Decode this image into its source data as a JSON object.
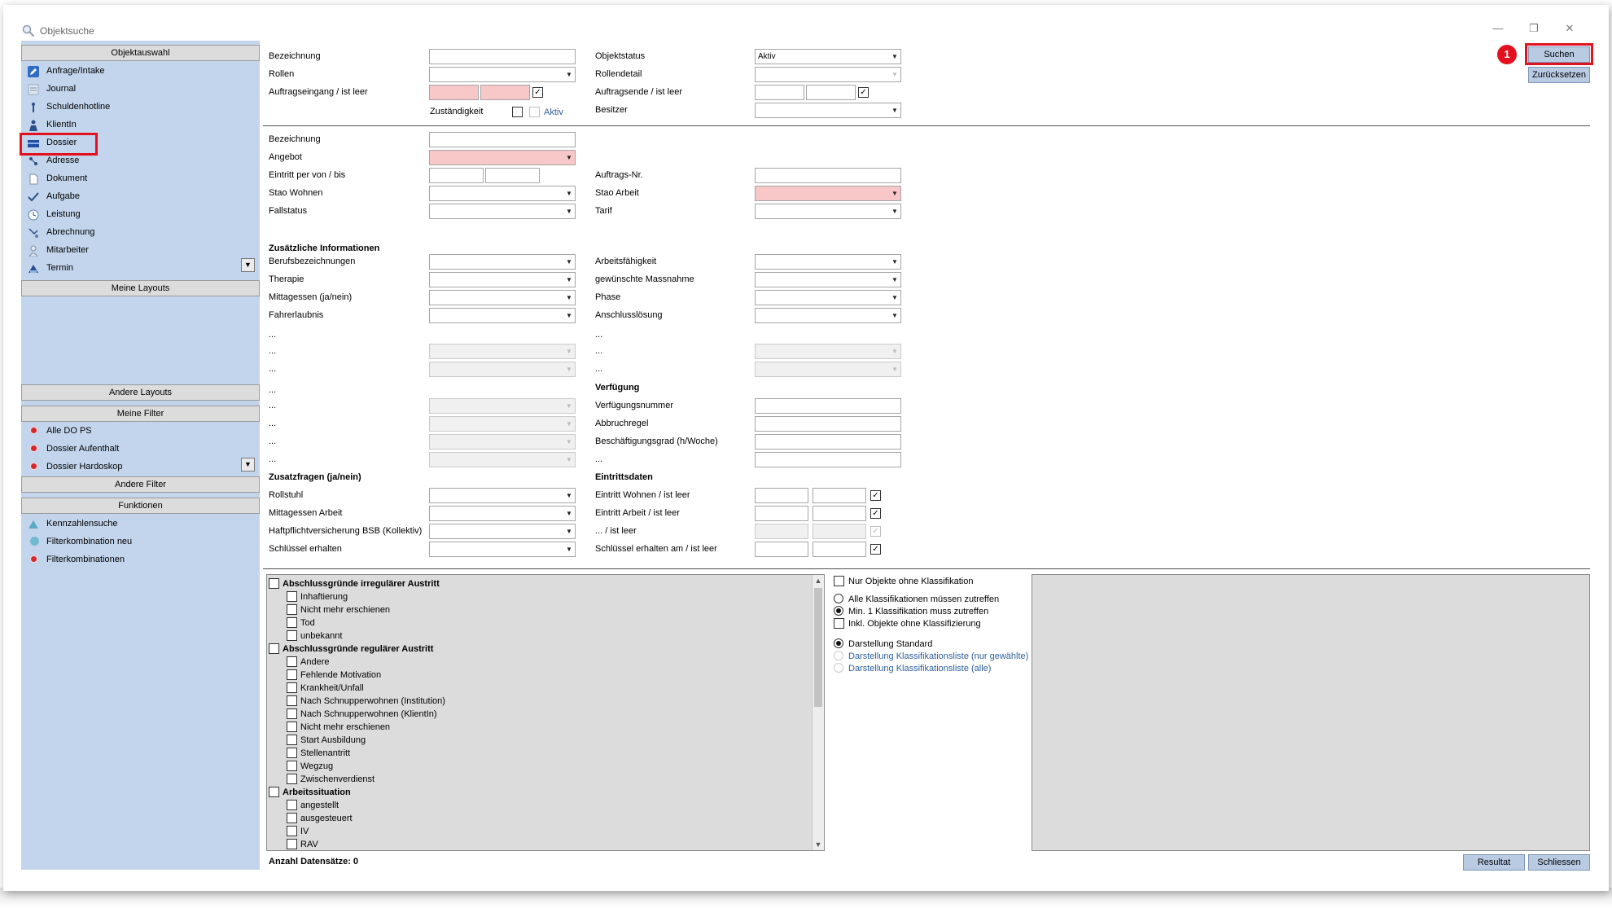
{
  "window": {
    "title": "Objektsuche",
    "controls": [
      "—",
      "❐",
      "✕"
    ]
  },
  "left": {
    "objektauswahl_header": "Objektauswahl",
    "objects": [
      {
        "label": "Anfrage/Intake",
        "icon": "pencil-icon"
      },
      {
        "label": "Journal",
        "icon": "journal-icon"
      },
      {
        "label": "Schuldenhotline",
        "icon": "person-icon"
      },
      {
        "label": "KlientIn",
        "icon": "client-icon"
      },
      {
        "label": "Dossier",
        "icon": "dossier-icon"
      },
      {
        "label": "Adresse",
        "icon": "address-icon"
      },
      {
        "label": "Dokument",
        "icon": "document-icon"
      },
      {
        "label": "Aufgabe",
        "icon": "checkmark-icon"
      },
      {
        "label": "Leistung",
        "icon": "clock-icon"
      },
      {
        "label": "Abrechnung",
        "icon": "billing-icon"
      },
      {
        "label": "Mitarbeiter",
        "icon": "employee-icon"
      },
      {
        "label": "Termin",
        "icon": "appointment-icon"
      }
    ],
    "meine_layouts_header": "Meine Layouts",
    "andere_layouts_header": "Andere Layouts",
    "meine_filter_header": "Meine Filter",
    "filters": [
      "Alle DO PS",
      "Dossier Aufenthalt",
      "Dossier Hardoskop"
    ],
    "andere_filter_header": "Andere Filter",
    "funktionen_header": "Funktionen",
    "functions": [
      {
        "label": "Kennzahlensuche",
        "icon": "teal-dot-icon"
      },
      {
        "label": "Filterkombination neu",
        "icon": "teal-dot-icon"
      },
      {
        "label": "Filterkombinationen",
        "icon": "red-dot-icon"
      }
    ]
  },
  "form": {
    "top": {
      "bezeichnung": "Bezeichnung",
      "rollen": "Rollen",
      "auftragseingang": "Auftragseingang / ist leer",
      "zustaendigkeit": "Zuständigkeit",
      "aktiv": "Aktiv",
      "objektstatus": "Objektstatus",
      "objektstatus_value": "Aktiv",
      "rollendetail": "Rollendetail",
      "auftragsende": "Auftragsende / ist leer",
      "besitzer": "Besitzer"
    },
    "dossier": {
      "bezeichnung": "Bezeichnung",
      "angebot": "Angebot",
      "eintritt": "Eintritt per von / bis",
      "stao_wohnen": "Stao Wohnen",
      "fallstatus": "Fallstatus",
      "auftrags_nr": "Auftrags-Nr.",
      "stao_arbeit": "Stao Arbeit",
      "tarif": "Tarif"
    },
    "zusatz": {
      "header": "Zusätzliche Informationen",
      "left": [
        "Berufsbezeichnungen",
        "Therapie",
        "Mittagessen (ja/nein)",
        "Fahrerlaubnis",
        "...",
        "...",
        "...",
        "...",
        "...",
        "...",
        "...",
        "..."
      ],
      "right": [
        "Arbeitsfähigkeit",
        "gewünschte Massnahme",
        "Phase",
        "Anschlusslösung",
        "...",
        "...",
        "..."
      ],
      "verfuegung_header": "Verfügung",
      "verfuegung": [
        "Verfügungsnummer",
        "Abbruchregel",
        "Beschäftigungsgrad (h/Woche)",
        "..."
      ]
    },
    "zusatzfragen": {
      "header": "Zusatzfragen (ja/nein)",
      "items": [
        "Rollstuhl",
        "Mittagessen Arbeit",
        "Haftpflichtversicherung BSB (Kollektiv)",
        "Schlüssel erhalten"
      ],
      "eintritt_header": "Eintrittsdaten",
      "eintritt": [
        "Eintritt Wohnen / ist leer",
        "Eintritt Arbeit / ist leer",
        "... / ist leer",
        "Schlüssel erhalten am / ist leer"
      ]
    }
  },
  "buttons": {
    "suchen": "Suchen",
    "zuruecksetzen": "Zurücksetzen",
    "resultat": "Resultat",
    "schliessen": "Schliessen"
  },
  "badge": "1",
  "classification": {
    "groups": [
      {
        "label": "Abschlussgründe irregulärer Austritt",
        "items": [
          "Inhaftierung",
          "Nicht mehr erschienen",
          "Tod",
          "unbekannt"
        ]
      },
      {
        "label": "Abschlussgründe regulärer Austritt",
        "items": [
          "Andere",
          "Fehlende Motivation",
          "Krankheit/Unfall",
          "Nach Schnupperwohnen (Institution)",
          "Nach Schnupperwohnen (KlientIn)",
          "Nicht mehr erschienen",
          "Start Ausbildung",
          "Stellenantritt",
          "Wegzug",
          "Zwischenverdienst"
        ]
      },
      {
        "label": "Arbeitssituation",
        "items": [
          "angestellt",
          "ausgesteuert",
          "IV",
          "RAV"
        ]
      }
    ],
    "options": {
      "nur_ohne": "Nur Objekte ohne Klassifikation",
      "alle_muessen": "Alle Klassifikationen müssen zutreffen",
      "min_eine": "Min. 1 Klassifikation muss zutreffen",
      "inkl_ohne": "Inkl. Objekte ohne Klassifizierung",
      "darst_standard": "Darstellung Standard",
      "darst_liste_gewaehlt": "Darstellung Klassifikationsliste (nur gewählte)",
      "darst_liste_alle": "Darstellung Klassifikationsliste (alle)"
    }
  },
  "status": {
    "anzahl": "Anzahl Datensätze: 0"
  }
}
